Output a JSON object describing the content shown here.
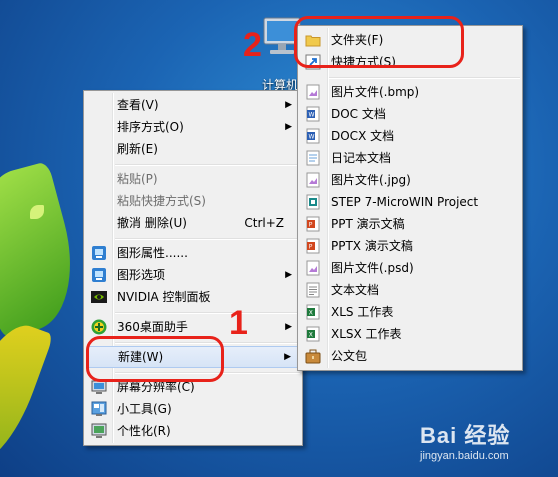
{
  "desktop": {
    "computer_label": "计算机"
  },
  "context_menu": {
    "items": [
      {
        "label": "查看(V)",
        "has_submenu": true
      },
      {
        "label": "排序方式(O)",
        "has_submenu": true
      },
      {
        "label": "刷新(E)"
      },
      {
        "label": "粘贴(P)",
        "disabled": true
      },
      {
        "label": "粘贴快捷方式(S)",
        "disabled": true
      },
      {
        "label": "撤消 删除(U)",
        "shortcut": "Ctrl+Z"
      },
      {
        "label": "图形属性......",
        "icon": "intel-graphics-icon"
      },
      {
        "label": "图形选项",
        "has_submenu": true,
        "icon": "intel-graphics-icon"
      },
      {
        "label": "NVIDIA 控制面板",
        "icon": "nvidia-icon"
      },
      {
        "label": "360桌面助手",
        "has_submenu": true,
        "icon": "360-icon"
      },
      {
        "label": "新建(W)",
        "has_submenu": true,
        "highlighted": true
      },
      {
        "label": "屏幕分辨率(C)",
        "icon": "display-icon"
      },
      {
        "label": "小工具(G)",
        "icon": "gadgets-icon"
      },
      {
        "label": "个性化(R)",
        "icon": "personalize-icon"
      }
    ]
  },
  "new_submenu": {
    "items": [
      {
        "label": "文件夹(F)",
        "icon": "folder-icon"
      },
      {
        "label": "快捷方式(S)",
        "icon": "shortcut-icon"
      },
      {
        "label": "图片文件(.bmp)",
        "icon": "bmp-icon"
      },
      {
        "label": "DOC 文档",
        "icon": "doc-icon"
      },
      {
        "label": "DOCX 文档",
        "icon": "docx-icon"
      },
      {
        "label": "日记本文档",
        "icon": "journal-icon"
      },
      {
        "label": "图片文件(.jpg)",
        "icon": "jpg-icon"
      },
      {
        "label": "STEP 7-MicroWIN Project",
        "icon": "step7-icon"
      },
      {
        "label": "PPT 演示文稿",
        "icon": "ppt-icon"
      },
      {
        "label": "PPTX 演示文稿",
        "icon": "pptx-icon"
      },
      {
        "label": "图片文件(.psd)",
        "icon": "psd-icon"
      },
      {
        "label": "文本文档",
        "icon": "txt-icon"
      },
      {
        "label": "XLS 工作表",
        "icon": "xls-icon"
      },
      {
        "label": "XLSX 工作表",
        "icon": "xlsx-icon"
      },
      {
        "label": "公文包",
        "icon": "briefcase-icon"
      }
    ]
  },
  "annotations": {
    "step1": "1",
    "step2": "2",
    "color": "#e8221a"
  },
  "watermark": {
    "brand": "Bai 经验",
    "url": "jingyan.baidu.com"
  }
}
